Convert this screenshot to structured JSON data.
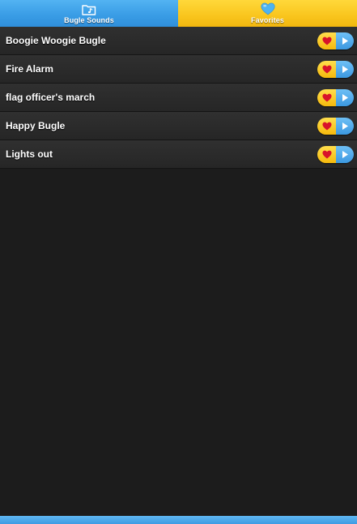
{
  "tabs": [
    {
      "label": "Bugle Sounds",
      "icon": "music-folder-icon",
      "color": "#3a9de6"
    },
    {
      "label": "Favorites",
      "icon": "heart-icon",
      "color": "#f9c51d"
    }
  ],
  "sounds": [
    {
      "title": "Boogie Woogie Bugle"
    },
    {
      "title": "Fire Alarm"
    },
    {
      "title": "flag officer's march"
    },
    {
      "title": "Happy Bugle"
    },
    {
      "title": "Lights out"
    }
  ],
  "colors": {
    "background": "#1c1c1c",
    "heart": "#d8132a",
    "play_arrow": "#ffffff"
  }
}
